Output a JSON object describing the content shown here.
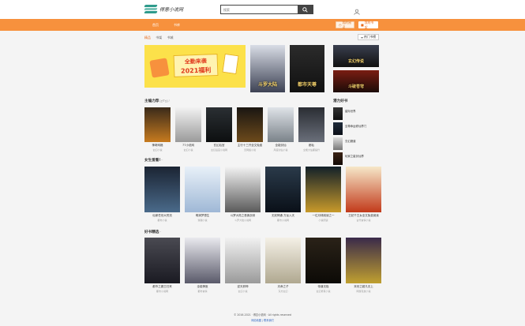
{
  "header": {
    "logo_text": "得意小说网",
    "search_placeholder": "搜索",
    "user_label": "登录"
  },
  "nav": {
    "items": [
      "首页",
      "书库"
    ],
    "history_label": "我的阅读",
    "shelf_label": "我的书架"
  },
  "breadcrumb": {
    "active": "精品",
    "items": [
      "书架",
      "书城"
    ]
  },
  "top_rank_label": "热门书榜",
  "banner": {
    "line1": "全勤来袭",
    "line2": "2021福利"
  },
  "colors": {
    "accent": "#f7913d",
    "brand": "#2f9b8c",
    "text": "#333333"
  },
  "sections": {
    "s1": {
      "title": "主编力荐",
      "emoticon": "(≧∇≦)ﾉ"
    },
    "s2": {
      "title": "女生爱看!",
      "emoticon": "~"
    },
    "s3": {
      "title": "好书精选",
      "emoticon": "~"
    },
    "hot": {
      "title": "潜力好书"
    }
  },
  "recommend": [
    {
      "title": "神奇网格",
      "author": "玄幻小说"
    },
    {
      "title": "77小说网",
      "author": "玄幻小说"
    },
    {
      "title": "玄幻后宫",
      "author": "玄幻后宫小说网"
    },
    {
      "title": "主行十三开全文免费",
      "author": "无网络小说"
    },
    {
      "title": "全能剑仙",
      "author": "风度剑仙小说"
    },
    {
      "title": "都仙",
      "author": "全能大仙都提升"
    }
  ],
  "hot_list": [
    {
      "title": "星际世界"
    },
    {
      "title": "至尊命运修仙界门"
    },
    {
      "title": "玄幻魔道"
    },
    {
      "title": "玩家之星剑仙界"
    }
  ],
  "female": [
    {
      "title": "仙家任世大荒流",
      "author": "都市小说"
    },
    {
      "title": "明清梦想生",
      "author": "穿越小说"
    },
    {
      "title": "斗罗大陆之首席战帝",
      "author": "斗罗大陆小说网"
    },
    {
      "title": "无双神通 万龙入天",
      "author": "都市小说网"
    },
    {
      "title": "一位月球阅读之一",
      "author": "小说阅读"
    },
    {
      "title": "王妃千王女全文免费阅读",
      "author": "古代言情小说"
    }
  ],
  "selected": [
    {
      "title": "都市之魔王归来",
      "author": "都市小说网"
    },
    {
      "title": "全能神医",
      "author": "都市言情"
    },
    {
      "title": "逆天邪神",
      "author": "玄幻小说"
    },
    {
      "title": "天命之子",
      "author": "东方玄幻"
    },
    {
      "title": "帝道无极",
      "author": "玄幻修真小说"
    },
    {
      "title": "末世之超凡无上",
      "author": "网游竞技小说"
    }
  ],
  "covers": {
    "feat1": "斗罗大陆",
    "feat2": "都市天尊",
    "feat3a": "玄幻传说",
    "feat3b": "斗破苍穹"
  },
  "footer": {
    "copyright": "© 2016-2021 · 得意小说网 · All rights reserved",
    "links": "网站地图 | 联系我们"
  }
}
